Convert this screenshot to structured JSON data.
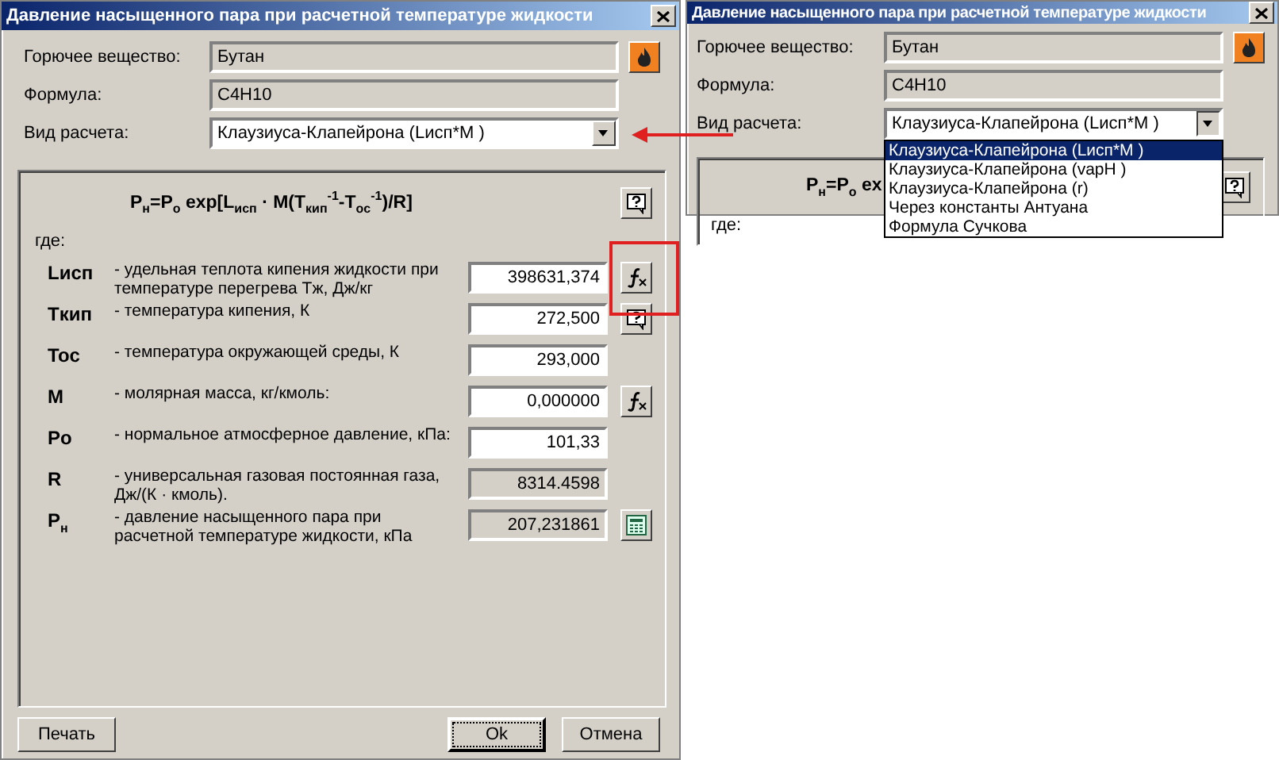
{
  "dialogs": [
    {
      "title": "Давление насыщенного пара при расчетной температуре жидкости",
      "substance": {
        "label": "Горючее вещество:",
        "value": "Бутан"
      },
      "formula": {
        "label": "Формула:",
        "value": "C4H10"
      },
      "method": {
        "label": "Вид расчета:",
        "value": "Клаузиуса-Клапейрона  (Lисп*M )",
        "expanded": false
      },
      "panel": {
        "equation": "P$_{н}$=P$_{o}$ exp[L$_{исп}$ · M(T$_{кип}$$^{-1}$-T$_{oc}$$^{-1}$)/R]",
        "where": "где:",
        "rows": [
          {
            "symbol": "Lисп",
            "description": "- удельная теплота кипения жидкости при температуре перегрева Tж, Дж/кг",
            "value": "398631,374",
            "readonly": false,
            "kind": "function"
          },
          {
            "symbol": "Tкип",
            "description": "- температура кипения, К",
            "value": "272,500",
            "readonly": false,
            "kind": "help"
          },
          {
            "symbol": "Toc",
            "description": "- температура окружающей среды, К",
            "value": "293,000",
            "readonly": false,
            "kind": "plain"
          },
          {
            "symbol": "M",
            "description": "- молярная масса, кг/кмоль:",
            "value": "0,000000",
            "readonly": false,
            "kind": "function"
          },
          {
            "symbol": "Po",
            "description": "- нормальное атмосферное давление, кПа:",
            "value": "101,33",
            "readonly": false,
            "kind": "plain"
          },
          {
            "symbol": "R",
            "description": "- универсальная газовая постоянная газа, Дж/(К · кмоль).",
            "value": "8314.4598",
            "readonly": true,
            "kind": "plain"
          },
          {
            "symbol": "P$_{н}$",
            "description": "- давление насыщенного пара при расчетной температуре жидкости, кПа",
            "value": "207,231861",
            "readonly": true,
            "kind": "calculator"
          }
        ]
      },
      "buttons": [
        {
          "label": "Печать",
          "focused": false
        },
        {
          "label": "Ok",
          "focused": true
        },
        {
          "label": "Отмена",
          "focused": false
        }
      ]
    },
    {
      "title": "Давление насыщенного пара при расчетной температуре жидкости",
      "substance": {
        "label": "Горючее вещество:",
        "value": "Бутан"
      },
      "formula": {
        "label": "Формула:",
        "value": "C4H10"
      },
      "method": {
        "label": "Вид расчета:",
        "value": "Клаузиуса-Клапейрона  (Lисп*M )",
        "expanded": true,
        "options": [
          {
            "label": "Клаузиуса-Клапейрона  (Lисп*M )",
            "selected": true
          },
          {
            "label": "Клаузиуса-Клапейрона  (vapH )",
            "selected": false
          },
          {
            "label": "Клаузиуса-Клапейрона  (r)",
            "selected": false
          },
          {
            "label": "Через константы Антуана",
            "selected": false
          },
          {
            "label": "Формула Сучкова",
            "selected": false
          }
        ]
      },
      "panel": {
        "equation": "P$_{н}$=P$_{o}$ ex",
        "where": "где:"
      }
    }
  ]
}
